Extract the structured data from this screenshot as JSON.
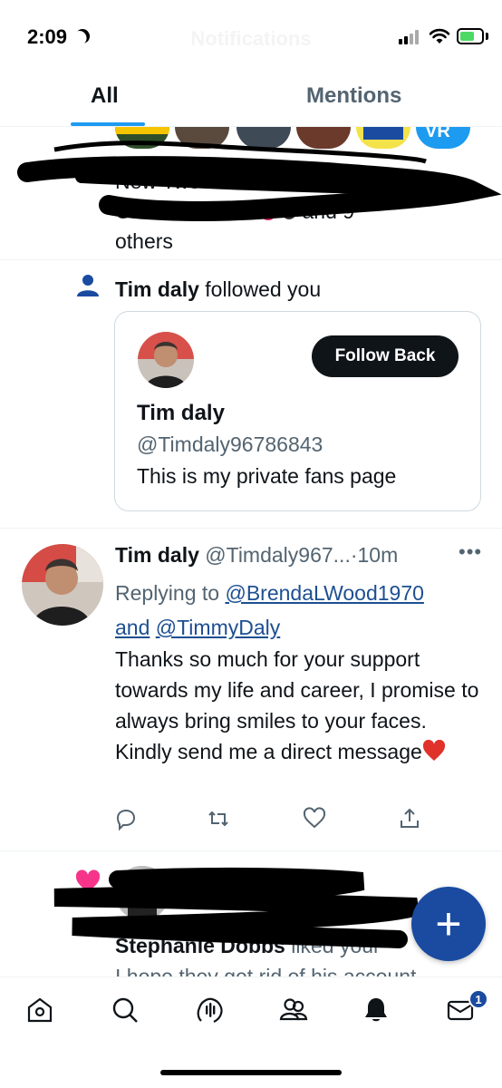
{
  "status_bar": {
    "time": "2:09",
    "faint_title": "Notifications"
  },
  "tabs": [
    {
      "label": "All",
      "active": true
    },
    {
      "label": "Mentions",
      "active": false
    }
  ],
  "notif_new_tweets": {
    "text_line1": "New Tweet notifications for",
    "text_line2": "Global Citizen",
    "text_line2_suffix": "and 9",
    "text_line3": "others"
  },
  "follow_notif": {
    "actor": "Tim daly",
    "action": "followed you",
    "card": {
      "name": "Tim daly",
      "handle": "@Timdaly96786843",
      "bio": "This is my private fans page",
      "button_label": "Follow Back"
    }
  },
  "tweet": {
    "name": "Tim daly",
    "handle": "@Timdaly967...",
    "separator": "·",
    "time": "10m",
    "more": "•••",
    "replying_prefix": "Replying to",
    "replying_user1": "@BrendaLWood1970",
    "replying_and": "and",
    "replying_user2": "@TimmyDaly",
    "body": "Thanks so much for your support towards my life and career, I promise to always bring smiles to your faces.  Kindly send me a direct message",
    "icons": [
      "reply-icon",
      "retweet-icon",
      "like-icon",
      "share-icon"
    ]
  },
  "liked_notif": {
    "actor": "Stephanie Dobbs",
    "action": "liked your",
    "preview": "I hope they get rid of his account"
  },
  "fab": {
    "label": "+"
  },
  "bottom_nav": {
    "items": [
      "home-icon",
      "search-icon",
      "spaces-icon",
      "communities-icon",
      "notifications-icon",
      "messages-icon"
    ],
    "messages_badge": "1"
  },
  "colors": {
    "accent": "#1d9bf0",
    "fab": "#1a4ba0",
    "link": "#1d4f91",
    "muted": "#536471"
  }
}
